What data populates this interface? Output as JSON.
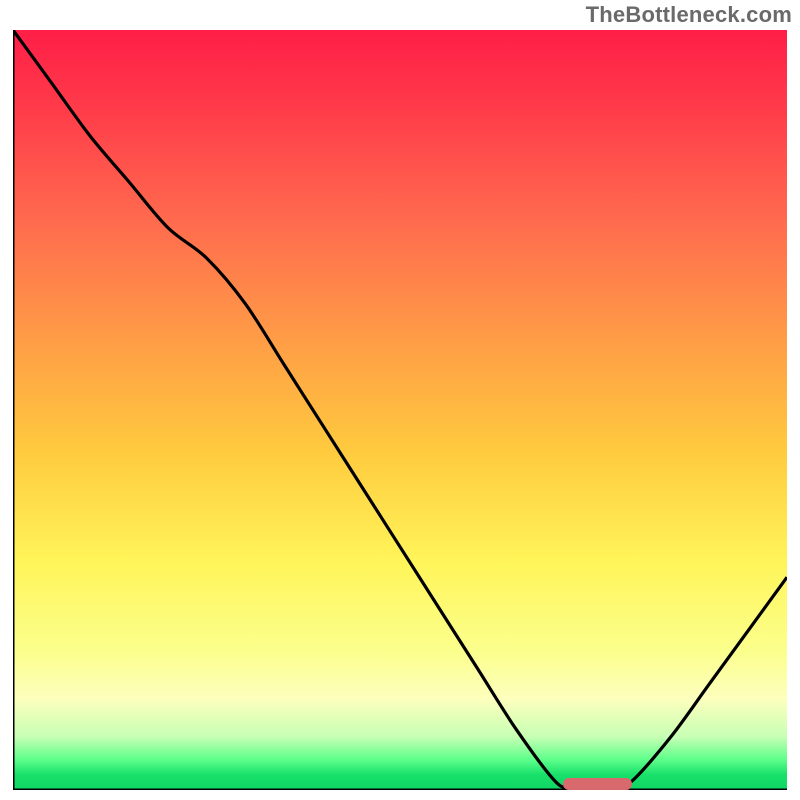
{
  "watermark": "TheBottleneck.com",
  "colors": {
    "curve_stroke": "#000000",
    "axis_stroke": "#000000",
    "marker_fill": "#d86a6e",
    "gradient_top": "#ff1e47",
    "gradient_bottom": "#0fd665"
  },
  "chart_data": {
    "type": "line",
    "title": "",
    "xlabel": "",
    "ylabel": "",
    "xlim": [
      0,
      1
    ],
    "ylim": [
      0,
      1
    ],
    "x": [
      0.0,
      0.05,
      0.1,
      0.15,
      0.2,
      0.25,
      0.3,
      0.35,
      0.4,
      0.45,
      0.5,
      0.55,
      0.6,
      0.65,
      0.7,
      0.72,
      0.75,
      0.78,
      0.8,
      0.85,
      0.9,
      0.95,
      1.0
    ],
    "values": [
      1.0,
      0.93,
      0.86,
      0.8,
      0.74,
      0.7,
      0.64,
      0.56,
      0.48,
      0.4,
      0.32,
      0.24,
      0.16,
      0.08,
      0.012,
      0.004,
      0.003,
      0.004,
      0.012,
      0.07,
      0.14,
      0.21,
      0.28
    ],
    "optimal_range_x": [
      0.71,
      0.8
    ],
    "annotations": []
  }
}
